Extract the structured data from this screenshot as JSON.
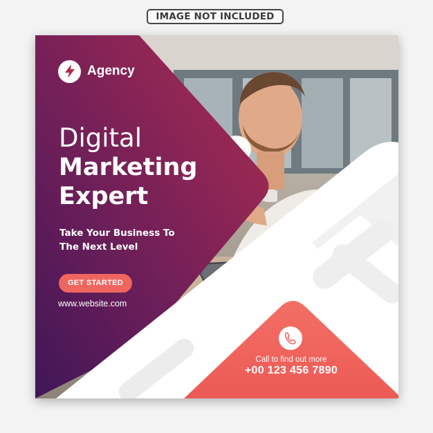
{
  "notice": "IMAGE NOT INCLUDED",
  "brand": {
    "name": "Agency",
    "logo_icon": "lightning-bolt-icon"
  },
  "headline": {
    "line1": "Digital",
    "line2": "Marketing",
    "line3": "Expert"
  },
  "tagline": {
    "line1": "Take Your Business To",
    "line2": "The Next Level"
  },
  "cta": {
    "label": "GET STARTED"
  },
  "website": "www.website.com",
  "contact": {
    "icon": "phone-icon",
    "label": "Call to find out more",
    "number": "+00 123 456 7890"
  },
  "colors": {
    "purple": "#4a1a5c",
    "magenta": "#a5284f",
    "coral": "#f0665f",
    "white": "#ffffff"
  }
}
